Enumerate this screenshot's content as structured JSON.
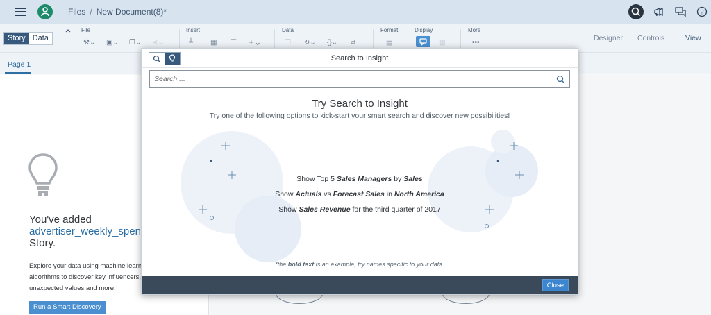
{
  "shell": {
    "breadcrumb_files": "Files",
    "breadcrumb_sep": "/",
    "document_title": "New Document(8)*"
  },
  "toolbar": {
    "mode_story": "Story",
    "mode_data": "Data",
    "groups": {
      "file": "File",
      "insert": "Insert",
      "data": "Data",
      "format": "Format",
      "display": "Display",
      "more": "More"
    },
    "designer": "Designer",
    "controls": "Controls",
    "view": "View"
  },
  "tabs": {
    "page1": "Page 1"
  },
  "left_panel": {
    "added_prefix": "You've added",
    "dataset_name": "advertiser_weekly_spend",
    "added_suffix_visible": "t",
    "added_story": "Story.",
    "explore_line1": "Explore your data using machine learn",
    "explore_line2": "algorithms to discover key influencers,",
    "explore_line3": "unexpected values and more.",
    "run_button": "Run a Smart Discovery"
  },
  "dialog": {
    "title": "Search to Insight",
    "search_placeholder": "Search ...",
    "try_title": "Try Search to Insight",
    "try_subtitle": "Try one of the following options to kick-start your smart search and discover new possibilities!",
    "suggestions": [
      {
        "pre": "Show Top 5 ",
        "b1": "Sales Managers",
        "mid": " by ",
        "b2": "Sales",
        "post": ""
      },
      {
        "pre": "Show ",
        "b1": "Actuals",
        "mid": " vs ",
        "b2": "Forecast Sales",
        "mid2": " in ",
        "b3": "North America"
      },
      {
        "pre": "Show ",
        "b1": "Sales Revenue",
        "post": " for the third quarter of 2017"
      }
    ],
    "hint_pre": "*the ",
    "hint_bold": "bold text",
    "hint_post": " is an example, try names specific to your data.",
    "close_button": "Close"
  },
  "icons": {
    "menu": "hamburger-icon",
    "home": "home-user-icon",
    "search": "search-icon",
    "announce": "megaphone-icon",
    "discuss": "discussion-icon",
    "help": "help-icon",
    "bulb": "lightbulb-icon"
  },
  "colors": {
    "shell_bg": "#d7e3ee",
    "accent": "#36597d",
    "link": "#2a6ea6",
    "button": "#4a8fd0",
    "footer": "#3b4a5a"
  }
}
